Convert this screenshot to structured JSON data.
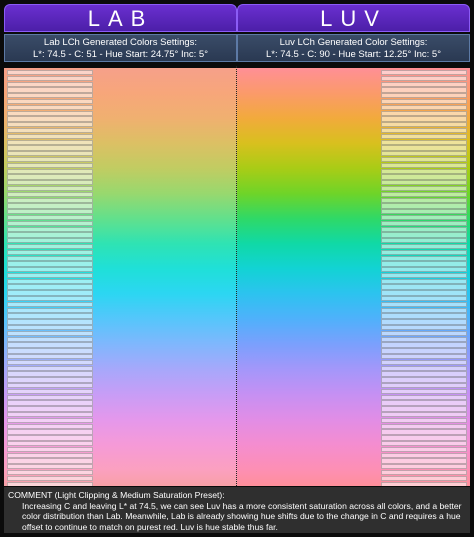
{
  "lab": {
    "title": "LAB",
    "settings_line1": "Lab LCh Generated Colors Settings:",
    "settings_line2": "L*: 74.5 - C: 51 - Hue Start: 24.75° Inc: 5°",
    "swatch_count": 72
  },
  "luv": {
    "title": "LUV",
    "settings_line1": "Luv LCh Generated Color Settings:",
    "settings_line2": "L*: 74.5 - C: 90 - Hue Start: 12.25° Inc: 5°",
    "swatch_count": 72
  },
  "comment": {
    "heading": "COMMENT (Light Clipping & Medium Saturation Preset):",
    "body": "Increasing C and leaving L* at 74.5, we can see Luv has a more consistent saturation across all colors, and a better color distribution than Lab. Meanwhile, Lab is already showing hue shifts due to the change in C and requires a hue offset to continue to match on purest red. Luv is hue stable thus far."
  },
  "colors": {
    "title_bar": "#5b26c0",
    "settings_bar": "#33445f",
    "comment_bg": "#2f2f2f",
    "page_bg": "#0b0b0b"
  }
}
